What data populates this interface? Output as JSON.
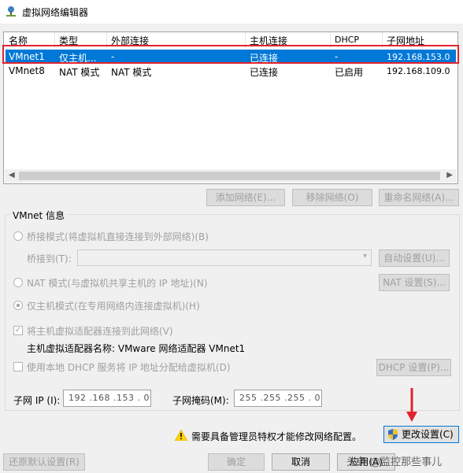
{
  "window": {
    "title": "虚拟网络编辑器"
  },
  "table": {
    "headers": [
      "名称",
      "类型",
      "外部连接",
      "主机连接",
      "DHCP",
      "子网地址"
    ],
    "rows": [
      {
        "name": "VMnet1",
        "type": "仅主机...",
        "external": "-",
        "host": "已连接",
        "dhcp": "-",
        "subnet": "192.168.153.0",
        "selected": true
      },
      {
        "name": "VMnet8",
        "type": "NAT 模式",
        "external": "NAT 模式",
        "host": "已连接",
        "dhcp": "已启用",
        "subnet": "192.168.109.0",
        "selected": false
      }
    ]
  },
  "list_buttons": {
    "add": "添加网络(E)...",
    "remove": "移除网络(O)",
    "rename": "重命名网络(A)..."
  },
  "vmnet_info": {
    "group_title": "VMnet 信息",
    "bridged_label": "桥接模式(将虚拟机直接连接到外部网络)(B)",
    "bridge_to_label": "桥接到(T):",
    "auto_settings_button": "自动设置(U)...",
    "nat_label": "NAT 模式(与虚拟机共享主机的 IP 地址)(N)",
    "nat_settings_button": "NAT 设置(S)...",
    "host_only_label": "仅主机模式(在专用网络内连接虚拟机)(H)",
    "connect_adapter_label": "将主机虚拟适配器连接到此网络(V)",
    "adapter_name_label": "主机虚拟适配器名称: VMware 网络适配器 VMnet1",
    "dhcp_label": "使用本地 DHCP 服务将 IP 地址分配给虚拟机(D)",
    "dhcp_settings_button": "DHCP 设置(P)...",
    "subnet_ip_label": "子网 IP (I):",
    "subnet_ip_value": "192 .168 .153 .  0",
    "subnet_mask_label": "子网掩码(M):",
    "subnet_mask_value": "255 .255 .255 .  0"
  },
  "admin": {
    "warning_text": "需要具备管理员特权才能修改网络配置。",
    "change_settings_button": "更改设置(C)"
  },
  "footer": {
    "restore_defaults": "还原默认设置(R)",
    "ok": "确定",
    "cancel": "取消",
    "apply": "应用(A)"
  },
  "watermark": "头条 @监控那些事儿",
  "colors": {
    "selection": "#0078d7",
    "highlight_box": "#e0242f",
    "arrow": "#e0242f"
  }
}
